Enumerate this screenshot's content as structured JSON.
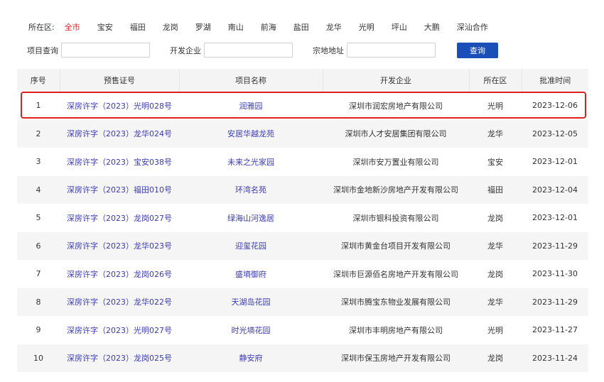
{
  "filters": {
    "district_label": "所在区:",
    "districts": [
      {
        "label": "全市",
        "active": true
      },
      {
        "label": "宝安",
        "active": false
      },
      {
        "label": "福田",
        "active": false
      },
      {
        "label": "龙岗",
        "active": false
      },
      {
        "label": "罗湖",
        "active": false
      },
      {
        "label": "南山",
        "active": false
      },
      {
        "label": "前海",
        "active": false
      },
      {
        "label": "盐田",
        "active": false
      },
      {
        "label": "龙华",
        "active": false
      },
      {
        "label": "光明",
        "active": false
      },
      {
        "label": "坪山",
        "active": false
      },
      {
        "label": "大鹏",
        "active": false
      },
      {
        "label": "深汕合作",
        "active": false
      }
    ]
  },
  "search": {
    "project_label": "项目查询",
    "project_value": "",
    "developer_label": "开发企业",
    "developer_value": "",
    "address_label": "宗地地址",
    "address_value": "",
    "button_label": "查询"
  },
  "table": {
    "headers": [
      "序号",
      "预售证号",
      "项目名称",
      "开发企业",
      "所在区",
      "批准时间"
    ],
    "rows": [
      {
        "no": "1",
        "permit": "深房许字（2023）光明028号",
        "project": "润雅园",
        "developer": "深圳市润宏房地产有限公司",
        "district": "光明",
        "date": "2023-12-06"
      },
      {
        "no": "2",
        "permit": "深房许字（2023）龙华024号",
        "project": "安居华越龙苑",
        "developer": "深圳市人才安居集团有限公司",
        "district": "龙华",
        "date": "2023-12-05"
      },
      {
        "no": "3",
        "permit": "深房许字（2023）宝安038号",
        "project": "未来之光家园",
        "developer": "深圳市安万置业有限公司",
        "district": "宝安",
        "date": "2023-12-01"
      },
      {
        "no": "4",
        "permit": "深房许字（2023）福田010号",
        "project": "环湾名苑",
        "developer": "深圳市金地新沙房地产开发有限公司",
        "district": "福田",
        "date": "2023-12-04"
      },
      {
        "no": "5",
        "permit": "深房许字（2023）龙岗027号",
        "project": "绿海山河逸居",
        "developer": "深圳市银科投资有限公司",
        "district": "龙岗",
        "date": "2023-12-01"
      },
      {
        "no": "6",
        "permit": "深房许字（2023）龙华023号",
        "project": "迎玺花园",
        "developer": "深圳市黄金台项目开发有限公司",
        "district": "龙华",
        "date": "2023-11-29"
      },
      {
        "no": "7",
        "permit": "深房许字（2023）龙岗026号",
        "project": "盛墒御府",
        "developer": "深圳市巨源佰名房地产开发有限公司",
        "district": "龙岗",
        "date": "2023-11-30"
      },
      {
        "no": "8",
        "permit": "深房许字（2023）龙华022号",
        "project": "天湖岛花园",
        "developer": "深圳市腾宝东物业发展有限公司",
        "district": "龙华",
        "date": "2023-11-29"
      },
      {
        "no": "9",
        "permit": "深房许字（2023）光明027号",
        "project": "时光墒花园",
        "developer": "深圳市丰明房地产有限公司",
        "district": "光明",
        "date": "2023-11-27"
      },
      {
        "no": "10",
        "permit": "深房许字（2023）龙岗025号",
        "project": "静安府",
        "developer": "深圳市保玉房地产开发有限公司",
        "district": "龙岗",
        "date": "2023-11-24"
      }
    ]
  },
  "highlight": {
    "row_index": 0,
    "color": "#e02020"
  },
  "colors": {
    "accent": "#1a4fba",
    "active_district": "#e02020",
    "link": "#3a3ab8"
  }
}
